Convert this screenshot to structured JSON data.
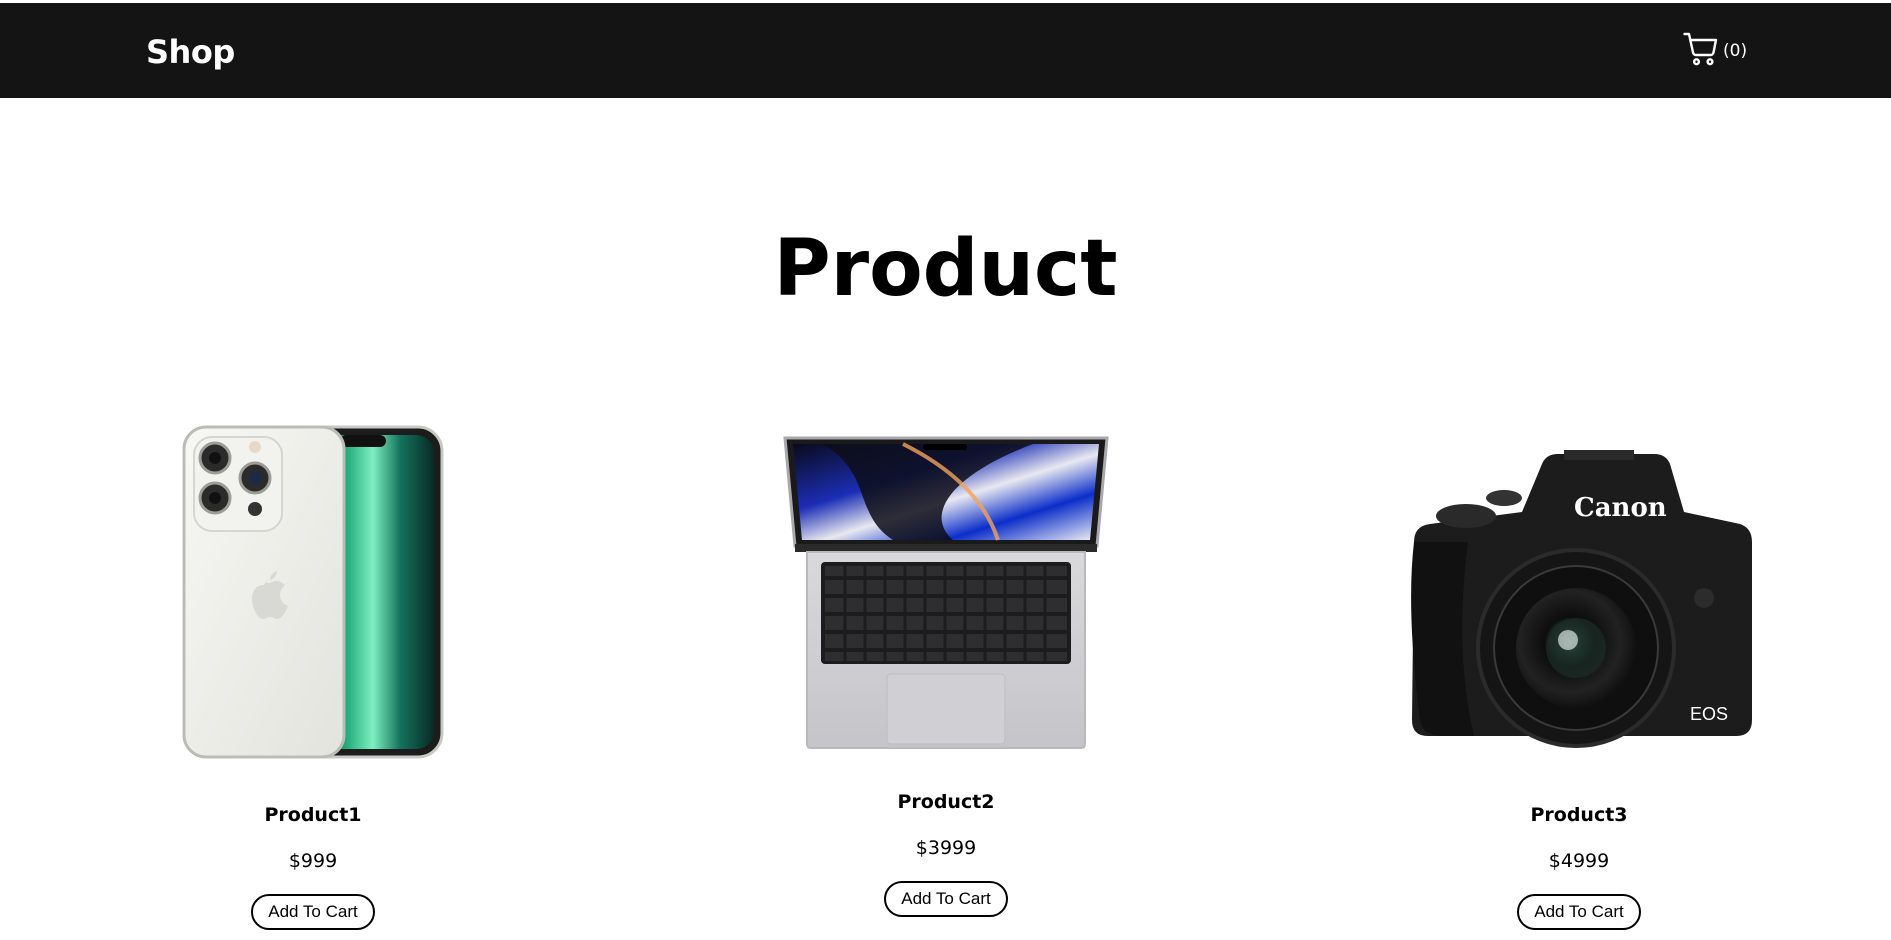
{
  "nav": {
    "brand": "Shop",
    "cart_icon": "shopping-cart-icon",
    "cart_count": "(0)"
  },
  "main": {
    "title": "Product"
  },
  "products": [
    {
      "name": "Product1",
      "price": "$999",
      "button": "Add To Cart",
      "image": "smartphone-image"
    },
    {
      "name": "Product2",
      "price": "$3999",
      "button": "Add To Cart",
      "image": "laptop-image"
    },
    {
      "name": "Product3",
      "price": "$4999",
      "button": "Add To Cart",
      "image": "camera-image"
    }
  ],
  "colors": {
    "navbar": "#141414",
    "text": "#000000",
    "background": "#ffffff"
  }
}
